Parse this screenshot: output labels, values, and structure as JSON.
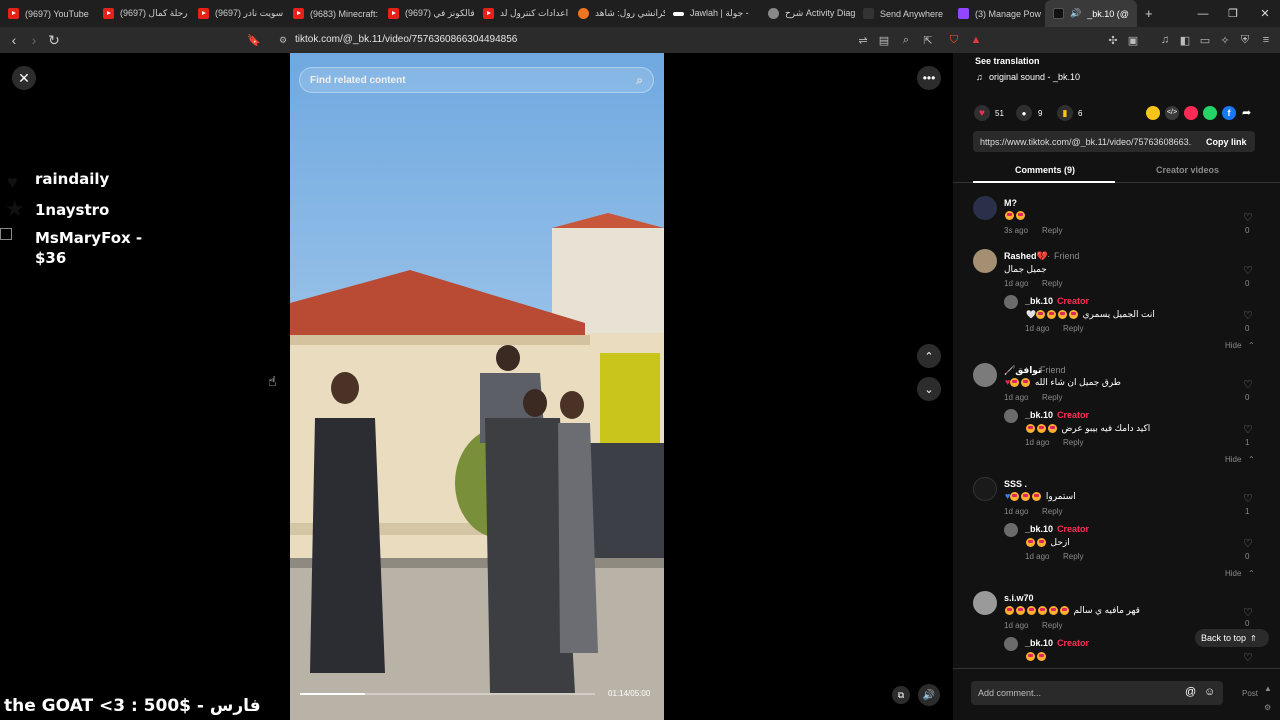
{
  "browser": {
    "tabs": [
      {
        "title": "(9697) YouTube",
        "icon": "youtube-icon"
      },
      {
        "title": "(9697) رحلة كمال",
        "icon": "youtube-icon"
      },
      {
        "title": "(9697) سويت نادر",
        "icon": "youtube-icon"
      },
      {
        "title": "(9683) Minecraft:",
        "icon": "youtube-icon"
      },
      {
        "title": "(9697) فالكونز في",
        "icon": "youtube-icon"
      },
      {
        "title": "اعدادات كنترول لد",
        "icon": "youtube-icon"
      },
      {
        "title": "كرانشي رول: شاهد",
        "icon": "crunchyroll-icon"
      },
      {
        "title": "Jawlah | جولة -",
        "icon": "jawlah-icon"
      },
      {
        "title": "شرح Activity Diagram",
        "icon": "chrome-icon"
      },
      {
        "title": "Send Anywhere",
        "icon": "sendanywhere-icon"
      },
      {
        "title": "(3) Manage Pow",
        "icon": "twitch-icon"
      },
      {
        "title": "_bk.10 (@",
        "icon": "tiktok-icon"
      }
    ],
    "new_tab": "+",
    "url": "tiktok.com/@_bk.11/video/7576360866304494856"
  },
  "overlay": {
    "names": [
      "raindaily",
      "1naystro",
      "MsMaryFox -",
      "$36"
    ],
    "bottom_text": "the GOAT <3 : 500$ - فارس"
  },
  "video": {
    "search_placeholder": "Find related content",
    "time": "01:14/05:00",
    "progress": 0.22
  },
  "sidebar": {
    "see_translation": "See translation",
    "sound": "original sound - _bk.10",
    "likes": "51",
    "comments_count": "9",
    "saves": "6",
    "link": "https://www.tiktok.com/@_bk.11/video/75763608663...",
    "copy_link": "Copy link",
    "tab_comments": "Comments (9)",
    "tab_creator": "Creator videos",
    "back_to_top": "Back to top",
    "add_comment": "Add comment...",
    "post": "Post",
    "comments": [
      {
        "user": "M?",
        "tag": "",
        "text": "",
        "time": "3s ago",
        "reply": "Reply",
        "likes": "0"
      },
      {
        "user": "Rashed💔",
        "tag": "Friend",
        "text": "جميل جمال",
        "time": "1d ago",
        "reply": "Reply",
        "likes": "0",
        "reply_user": "_bk.10",
        "reply_tag": "Creator",
        "reply_text": "انت الجميل يسمري",
        "reply_time": "1d ago",
        "reply_likes": "0"
      },
      {
        "user": "🦯توافق",
        "tag": "Friend",
        "text": "طرق جميل ان شاء الله",
        "time": "1d ago",
        "reply": "Reply",
        "likes": "0",
        "reply_user": "_bk.10",
        "reply_tag": "Creator",
        "reply_text": "اكيد دامك فيه بيبو عرض",
        "reply_time": "1d ago",
        "reply_likes": "1"
      },
      {
        "user": "SSS .",
        "tag": "",
        "text": "استمروا",
        "time": "1d ago",
        "reply": "Reply",
        "likes": "1",
        "reply_user": "_bk.10",
        "reply_tag": "Creator",
        "reply_text": "ازحل",
        "reply_time": "1d ago",
        "reply_likes": "0"
      },
      {
        "user": "s.i.w70",
        "tag": "",
        "text": "قهر مافيه ي سالم",
        "time": "1d ago",
        "reply": "Reply",
        "likes": "0",
        "reply_user": "_bk.10",
        "reply_tag": "Creator",
        "reply_text": "",
        "reply_time": "",
        "reply_likes": ""
      }
    ],
    "hide": "Hide",
    "sep": "·"
  }
}
